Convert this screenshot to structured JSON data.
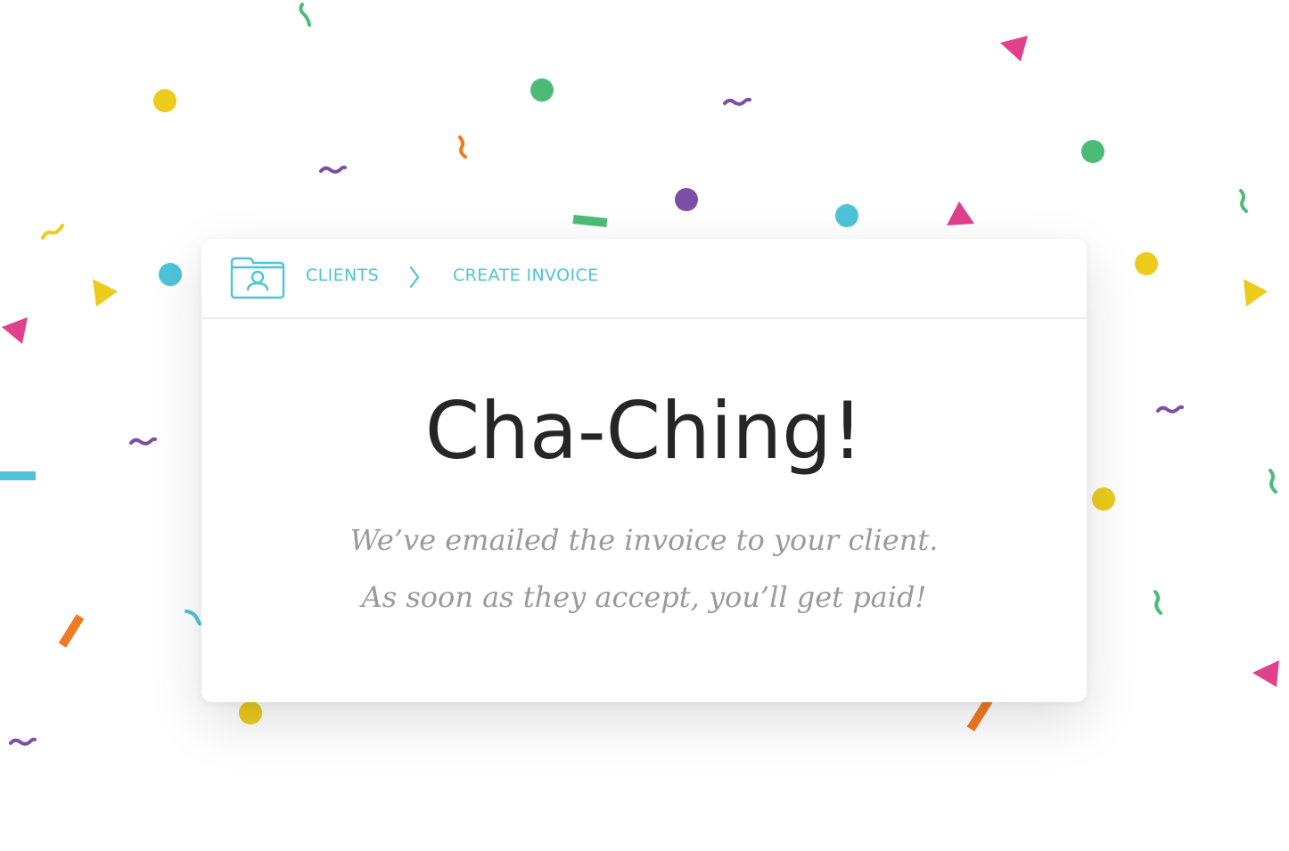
{
  "breadcrumb": {
    "icon": "client-folder-icon",
    "items": [
      {
        "label": "CLIENTS"
      },
      {
        "label": "CREATE INVOICE"
      }
    ],
    "separator_icon": "chevron-right-icon"
  },
  "success": {
    "headline": "Cha-Ching!",
    "message_line_1": "We’ve emailed the invoice to your client.",
    "message_line_2": "As soon as they accept, you’ll get paid!"
  },
  "colors": {
    "accent": "#4fc3d9",
    "confetti_yellow": "#eccb1c",
    "confetti_green": "#4dbb78",
    "confetti_purple": "#7c4fa6",
    "confetti_cyan": "#4fc3d9",
    "confetti_pink": "#e0408c",
    "confetti_orange": "#f07a24"
  }
}
